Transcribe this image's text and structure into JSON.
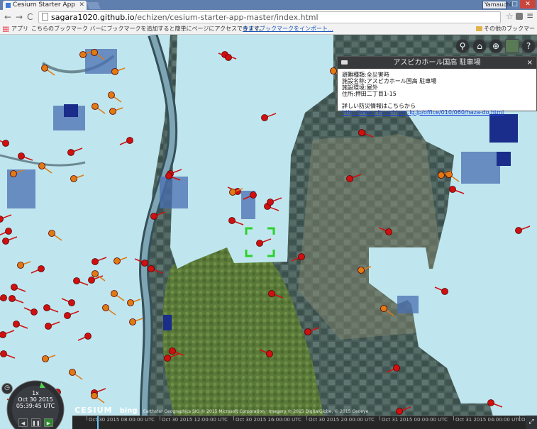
{
  "browser": {
    "tab_title": "Cesium Starter App",
    "user": "Yamauchi",
    "url_host": "sagara1020.github.io",
    "url_path": "/echizen/cesium-starter-app-master/index.html",
    "apps_label": "アプリ",
    "bookmark_hint": "こちらのブックマーク バーにブックマークを追加すると簡単にページにアクセスできます。",
    "import_link": "今すぐブックマークをインポート...",
    "other_bookmarks": "その他のブックマーク"
  },
  "toolbar_icons": [
    "search-icon",
    "home-icon",
    "globe-icon",
    "imagery-icon",
    "help-icon"
  ],
  "infobox": {
    "title": "アスピカホール国高 駐車場",
    "lines": [
      "避難種類:全災害時",
      "施設名称:アスピカホール国高 駐車場",
      "施設環境:屋外",
      "住所:押田二丁目1-15"
    ],
    "more_text": "詳しい防災情報はこちらから",
    "link": "http://www.city.echizen.lg.jp/office/010/060/haza-do.html"
  },
  "animation": {
    "speed": "1x",
    "date": "Oct 30 2015",
    "time": "05:39:45 UTC"
  },
  "timeline_labels": [
    "Oct 30 2015 08:00:00 UTC",
    "Oct 30 2015 12:00:00 UTC",
    "Oct 30 2015 16:00:00 UTC",
    "Oct 30 2015 20:00:00 UTC",
    "Oct 31 2015 00:00:00 UTC",
    "Oct 31 2015 04:00:00 UTC",
    "Oct 31 2015"
  ],
  "credits": {
    "cesium": "CESIUM",
    "bing": "bing",
    "text": "Earthstar Geographics SIO © 2015 Microsoft Corporation · Imagery © 2015 DigitalGlobe, © 2015 Geoeye"
  },
  "colors": {
    "evacuation_marker": "#d01010",
    "shelter_marker": "#e07a12",
    "hazard_light": "#bfe6ee",
    "hazard_dark": "#1b2d8a",
    "selection": "#2bd12b"
  }
}
